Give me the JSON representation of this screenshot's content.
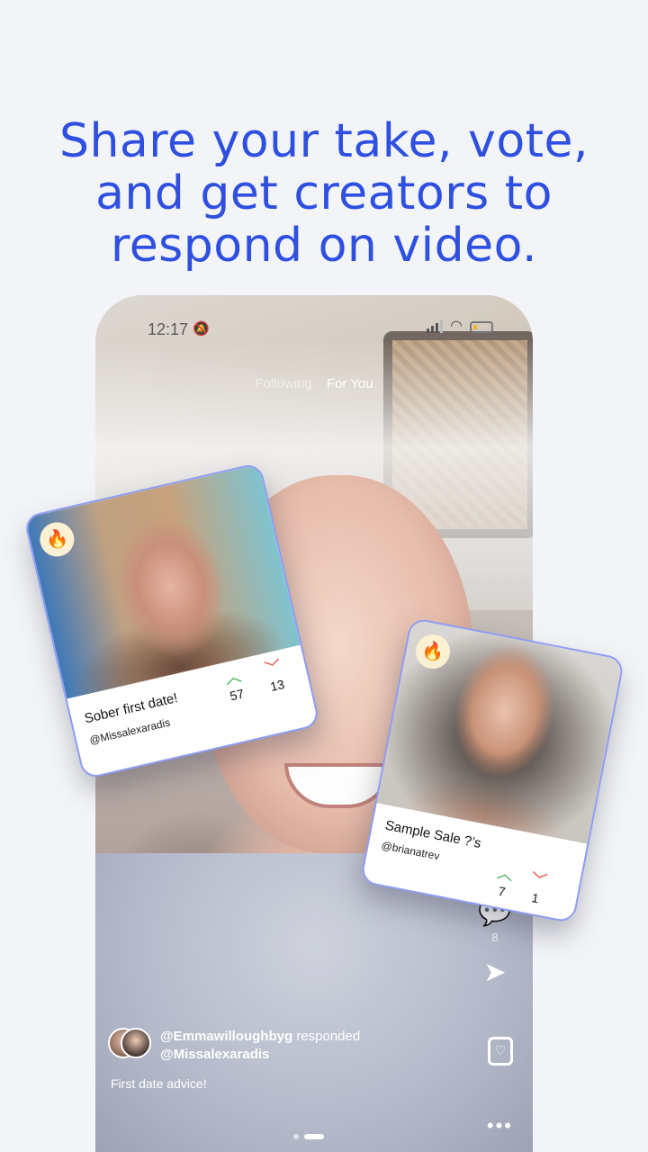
{
  "headline": {
    "line1": "Share your take, vote,",
    "line2": "and get creators to",
    "line3": "respond on video."
  },
  "colors": {
    "accent": "#2e4fe0",
    "up": "#3aa94a",
    "down": "#e04438",
    "card_border": "#8e9cf2"
  },
  "phone": {
    "status_time": "12:17",
    "tabs": [
      {
        "label": "Following"
      },
      {
        "label": "For You"
      }
    ],
    "side_actions": {
      "comment_count": "8"
    },
    "response": {
      "responder": "@Emmawilloughbyg",
      "verb": "responded",
      "original": "@Missalexaradis",
      "caption": "First date advice!"
    }
  },
  "cards": [
    {
      "title": "Sober first date!",
      "user": "@Missalexaradis",
      "up": "57",
      "down": "13",
      "icon": "fire-icon"
    },
    {
      "title": "Sample Sale ?’s",
      "user": "@brianatrev",
      "up": "7",
      "down": "1",
      "icon": "fire-icon"
    }
  ]
}
